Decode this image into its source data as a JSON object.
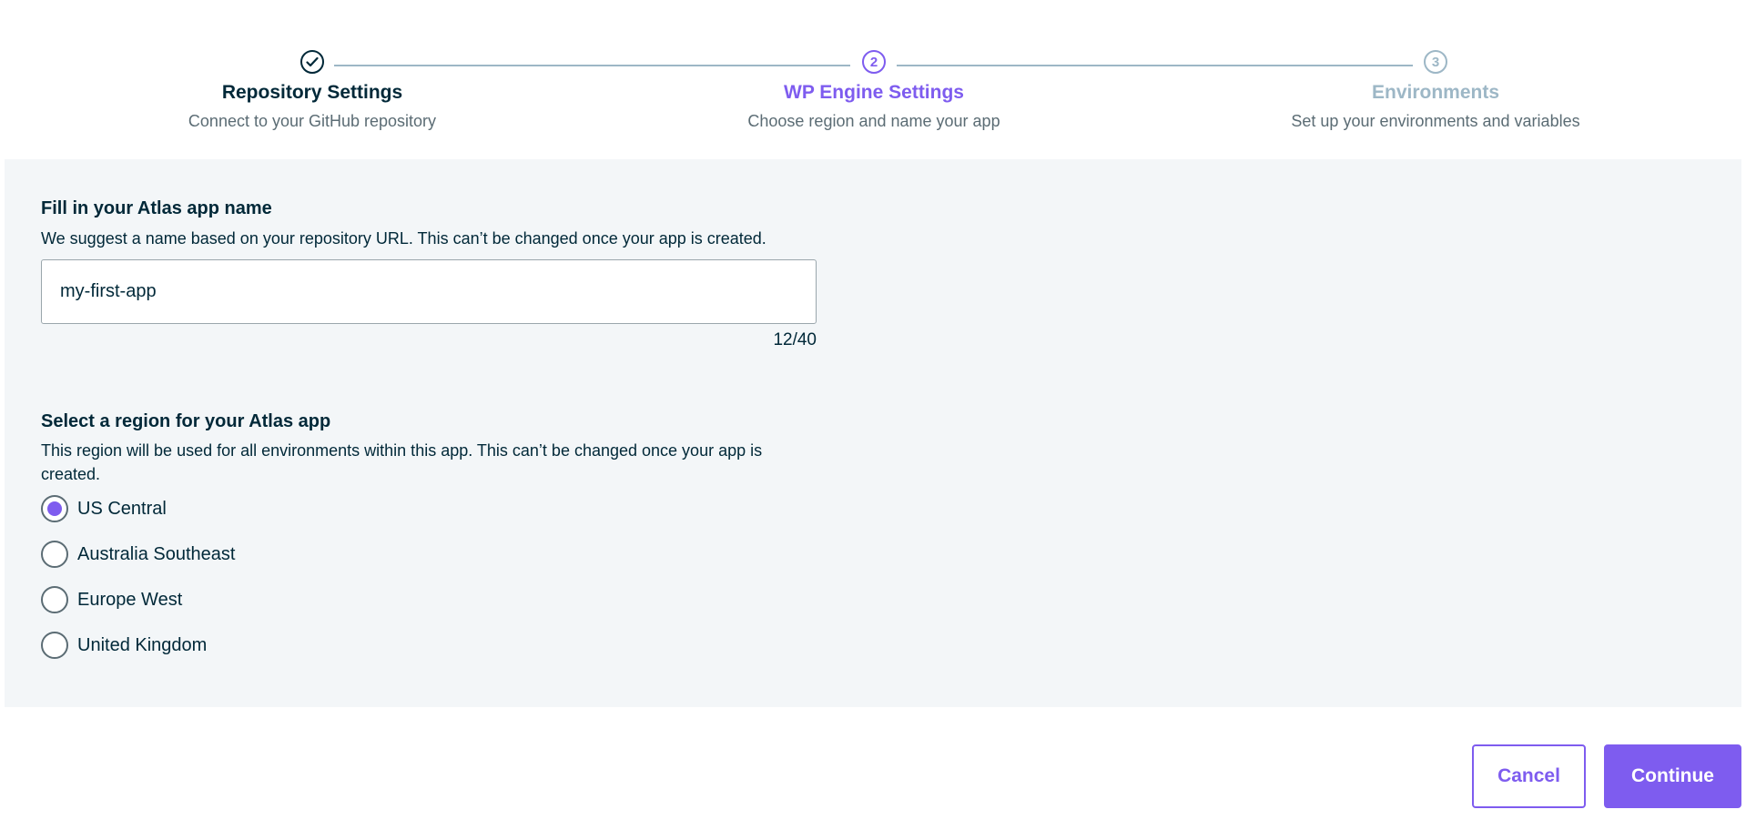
{
  "stepper": {
    "steps": [
      {
        "number": "✓",
        "title": "Repository Settings",
        "subtitle": "Connect to your GitHub repository",
        "state": "complete"
      },
      {
        "number": "2",
        "title": "WP Engine Settings",
        "subtitle": "Choose region and name your app",
        "state": "active"
      },
      {
        "number": "3",
        "title": "Environments",
        "subtitle": "Set up your environments and variables",
        "state": "upcoming"
      }
    ]
  },
  "app_name": {
    "title": "Fill in your Atlas app name",
    "description": "We suggest a name based on your repository URL. This can’t be changed once your app is created.",
    "value": "my-first-app",
    "counter": "12/40"
  },
  "region": {
    "title": "Select a region for your Atlas app",
    "description": "This region will be used for all environments within this app. This can’t be changed once your app is created.",
    "options": [
      {
        "label": "US Central",
        "selected": true
      },
      {
        "label": "Australia Southeast",
        "selected": false
      },
      {
        "label": "Europe West",
        "selected": false
      },
      {
        "label": "United Kingdom",
        "selected": false
      }
    ]
  },
  "footer": {
    "cancel_label": "Cancel",
    "continue_label": "Continue"
  },
  "colors": {
    "accent": "#7e5cef",
    "text": "#002838",
    "muted": "#9db7c6",
    "panel_bg": "#f3f6f8"
  }
}
